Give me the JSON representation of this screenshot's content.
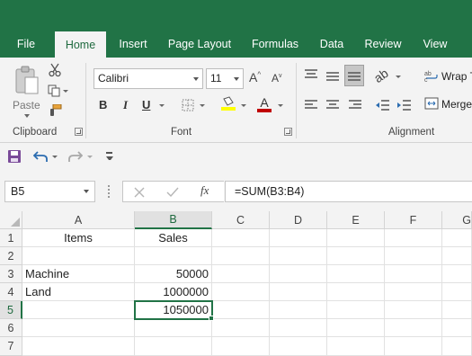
{
  "tabs": [
    {
      "label": "File",
      "active": false
    },
    {
      "label": "Home",
      "active": true
    },
    {
      "label": "Insert",
      "active": false
    },
    {
      "label": "Page Layout",
      "active": false
    },
    {
      "label": "Formulas",
      "active": false
    },
    {
      "label": "Data",
      "active": false
    },
    {
      "label": "Review",
      "active": false
    },
    {
      "label": "View",
      "active": false
    }
  ],
  "ribbon": {
    "clipboard": {
      "paste_label": "Paste",
      "group_label": "Clipboard"
    },
    "font": {
      "font_name": "Calibri",
      "font_size": "11",
      "bold": "B",
      "italic": "I",
      "underline": "U",
      "grow": "A",
      "shrink": "A",
      "color_letter": "A",
      "group_label": "Font"
    },
    "alignment": {
      "wrap_label": "Wrap T",
      "merge_label": "Merge",
      "group_label": "Alignment"
    }
  },
  "qat": {
    "icons": [
      "save-icon",
      "undo-icon",
      "redo-icon",
      "customize-icon"
    ]
  },
  "formula_bar": {
    "name_box": "B5",
    "fx": "fx",
    "formula": "=SUM(B3:B4)"
  },
  "sheet": {
    "columns": [
      "A",
      "B",
      "C",
      "D",
      "E",
      "F",
      "G"
    ],
    "rows": [
      "1",
      "2",
      "3",
      "4",
      "5",
      "6",
      "7"
    ],
    "selected_cell": "B5",
    "cells": {
      "A1": "Items",
      "B1": "Sales",
      "A3": "Machine",
      "B3": "50000",
      "A4": "Land",
      "B4": "1000000",
      "B5": "1050000"
    }
  },
  "colors": {
    "accent": "#217346",
    "ribbon_bg": "#f3f3f3"
  }
}
